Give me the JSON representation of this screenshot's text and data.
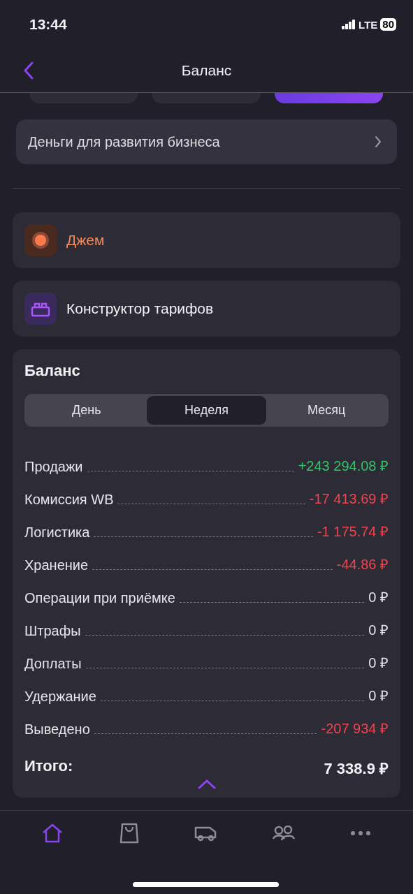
{
  "status_bar": {
    "time": "13:44",
    "network": "LTE",
    "battery": "80"
  },
  "header": {
    "title": "Баланс"
  },
  "filter_chips": [
    {
      "selected": false
    },
    {
      "selected": false
    },
    {
      "selected": true
    }
  ],
  "promo_link": {
    "label": "Деньги для развития бизнеса"
  },
  "services": [
    {
      "kind": "jam",
      "label": "Джем"
    },
    {
      "kind": "tariff",
      "label": "Конструктор тарифов"
    }
  ],
  "balance": {
    "title": "Баланс",
    "periods": [
      {
        "label": "День",
        "selected": false
      },
      {
        "label": "Неделя",
        "selected": true
      },
      {
        "label": "Месяц",
        "selected": false
      }
    ],
    "rows": [
      {
        "label": "Продажи",
        "value": "+243 294.08 ₽",
        "kind": "income"
      },
      {
        "label": "Комиссия WB",
        "value": "-17 413.69 ₽",
        "kind": "expense"
      },
      {
        "label": "Логистика",
        "value": "-1 175.74 ₽",
        "kind": "expense"
      },
      {
        "label": "Хранение",
        "value": "-44.86 ₽",
        "kind": "expense"
      },
      {
        "label": "Операции при приёмке",
        "value": "0 ₽",
        "kind": "zero"
      },
      {
        "label": "Штрафы",
        "value": "0 ₽",
        "kind": "zero"
      },
      {
        "label": "Доплаты",
        "value": "0 ₽",
        "kind": "zero"
      },
      {
        "label": "Удержание",
        "value": "0 ₽",
        "kind": "zero"
      },
      {
        "label": "Выведено",
        "value": "-207 934 ₽",
        "kind": "expense"
      }
    ],
    "total_label": "Итого:",
    "total_value": "7 338.9 ₽"
  },
  "tab_bar": [
    {
      "kind": "home",
      "selected": true
    },
    {
      "kind": "bag",
      "selected": false
    },
    {
      "kind": "truck",
      "selected": false
    },
    {
      "kind": "people",
      "selected": false
    },
    {
      "kind": "more",
      "selected": false
    }
  ]
}
